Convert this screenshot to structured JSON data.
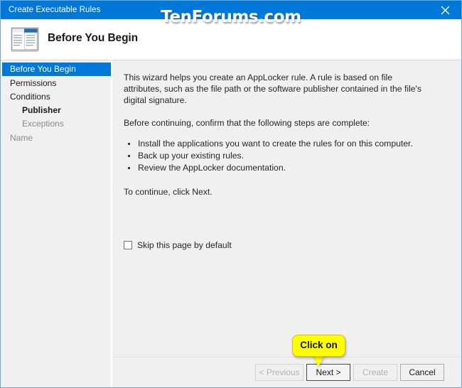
{
  "window": {
    "title": "Create Executable Rules",
    "close_icon": "close-icon",
    "watermark": "TenForums.com",
    "accent_color": "#0078d7",
    "body_background": "#f0f0f0"
  },
  "header": {
    "icon": "wizard-window-icon",
    "title": "Before You Begin"
  },
  "sidebar": {
    "items": [
      {
        "label": "Before You Begin",
        "state": "selected",
        "indent": 0
      },
      {
        "label": "Permissions",
        "state": "normal",
        "indent": 0
      },
      {
        "label": "Conditions",
        "state": "normal",
        "indent": 0
      },
      {
        "label": "Publisher",
        "state": "bold",
        "indent": 1
      },
      {
        "label": "Exceptions",
        "state": "dim",
        "indent": 1
      },
      {
        "label": "Name",
        "state": "dim",
        "indent": 0
      }
    ]
  },
  "main": {
    "intro": "This wizard helps you create an AppLocker rule. A rule is based on file attributes, such as the file path or the software publisher contained in the file's digital signature.",
    "confirm_line": "Before continuing, confirm that the following steps are complete:",
    "steps": [
      "Install the applications you want to create the rules for on this computer.",
      "Back up your existing rules.",
      "Review the AppLocker documentation."
    ],
    "continue_line": "To continue, click Next.",
    "skip_checkbox": {
      "label": "Skip this page by default",
      "checked": false
    }
  },
  "footer": {
    "previous_label": "< Previous",
    "next_label": "Next >",
    "create_label": "Create",
    "cancel_label": "Cancel"
  },
  "callout": {
    "text": "Click on",
    "color": "#ffff00",
    "points_to": "next-button"
  }
}
